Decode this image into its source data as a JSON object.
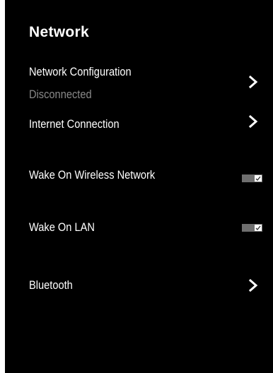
{
  "page": {
    "title": "Network"
  },
  "items": [
    {
      "id": "network-configuration",
      "label": "Network Configuration",
      "subtitle": "Disconnected",
      "control": "chevron-right-icon"
    },
    {
      "id": "internet-connection",
      "label": "Internet Connection",
      "control": "chevron-right-icon"
    },
    {
      "id": "wake-on-wireless",
      "label": "Wake On Wireless Network",
      "control": "toggle",
      "checked": true
    },
    {
      "id": "wake-on-lan",
      "label": "Wake On LAN",
      "control": "toggle",
      "checked": true
    },
    {
      "id": "bluetooth",
      "label": "Bluetooth",
      "control": "chevron-right-icon"
    }
  ],
  "colors": {
    "background": "#000000",
    "text": "#ffffff",
    "subtitle": "#8a8a8a",
    "toggle_track": "#6f6f6f"
  }
}
